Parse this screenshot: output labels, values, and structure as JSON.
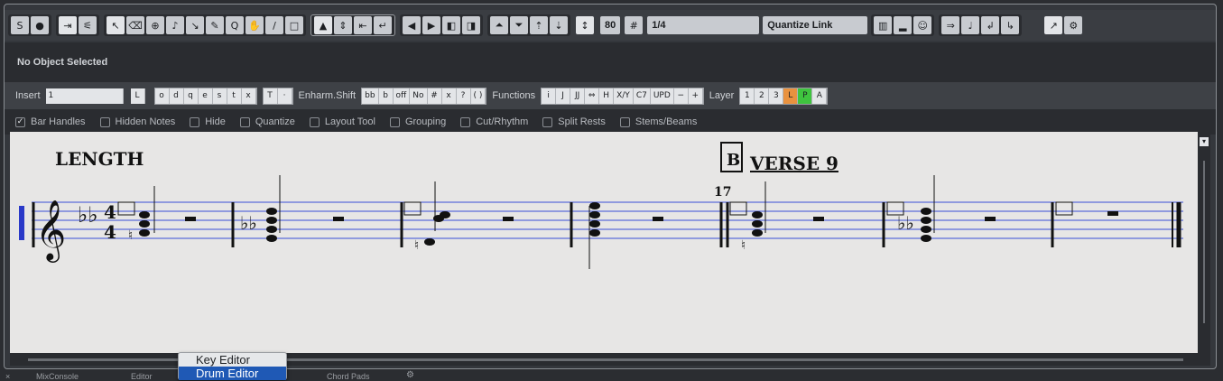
{
  "toolbar": {
    "velocity": "80",
    "quantize_value": "1/4",
    "quantize_link": "Quantize Link"
  },
  "status": {
    "text": "No Object Selected"
  },
  "ext": {
    "insert_label": "Insert",
    "insert_value": "1",
    "insert_L": "L",
    "enharm_label": "Enharm.Shift",
    "enharm_buttons": [
      "bb",
      "b",
      "off",
      "No",
      "#",
      "x",
      "?",
      "( )"
    ],
    "functions_label": "Functions",
    "functions_buttons": [
      "i",
      "J",
      "JJ",
      "⇔",
      "H",
      "X/Y",
      "C7",
      "UPD",
      "−",
      "+"
    ],
    "layer_label": "Layer",
    "layer_buttons": [
      "1",
      "2",
      "3",
      "L",
      "P",
      "A"
    ],
    "note_values": [
      "o",
      "d",
      "q",
      "e",
      "s",
      "t",
      "x"
    ],
    "t_button": "T",
    "dot_button": "·"
  },
  "options": [
    "Bar Handles",
    "Hidden Notes",
    "Hide",
    "Quantize",
    "Layout Tool",
    "Grouping",
    "Cut/Rhythm",
    "Split Rests",
    "Stems/Beams"
  ],
  "score": {
    "text_length": "LENGTH",
    "rehearsal_mark": "B",
    "verse_label": "VERSE 9",
    "bar_number": "17",
    "time_sig_top": "4",
    "time_sig_bottom": "4"
  },
  "popup": {
    "items": [
      "Key Editor",
      "Drum Editor"
    ]
  },
  "bottom_tabs": [
    "MixConsole",
    "Editor",
    "Chord Pads"
  ],
  "colors": {
    "staff_line": "#3a4fd8",
    "accent_blue": "#1f59b5",
    "layer_L": "#e9923f",
    "layer_P": "#3fc43f"
  }
}
